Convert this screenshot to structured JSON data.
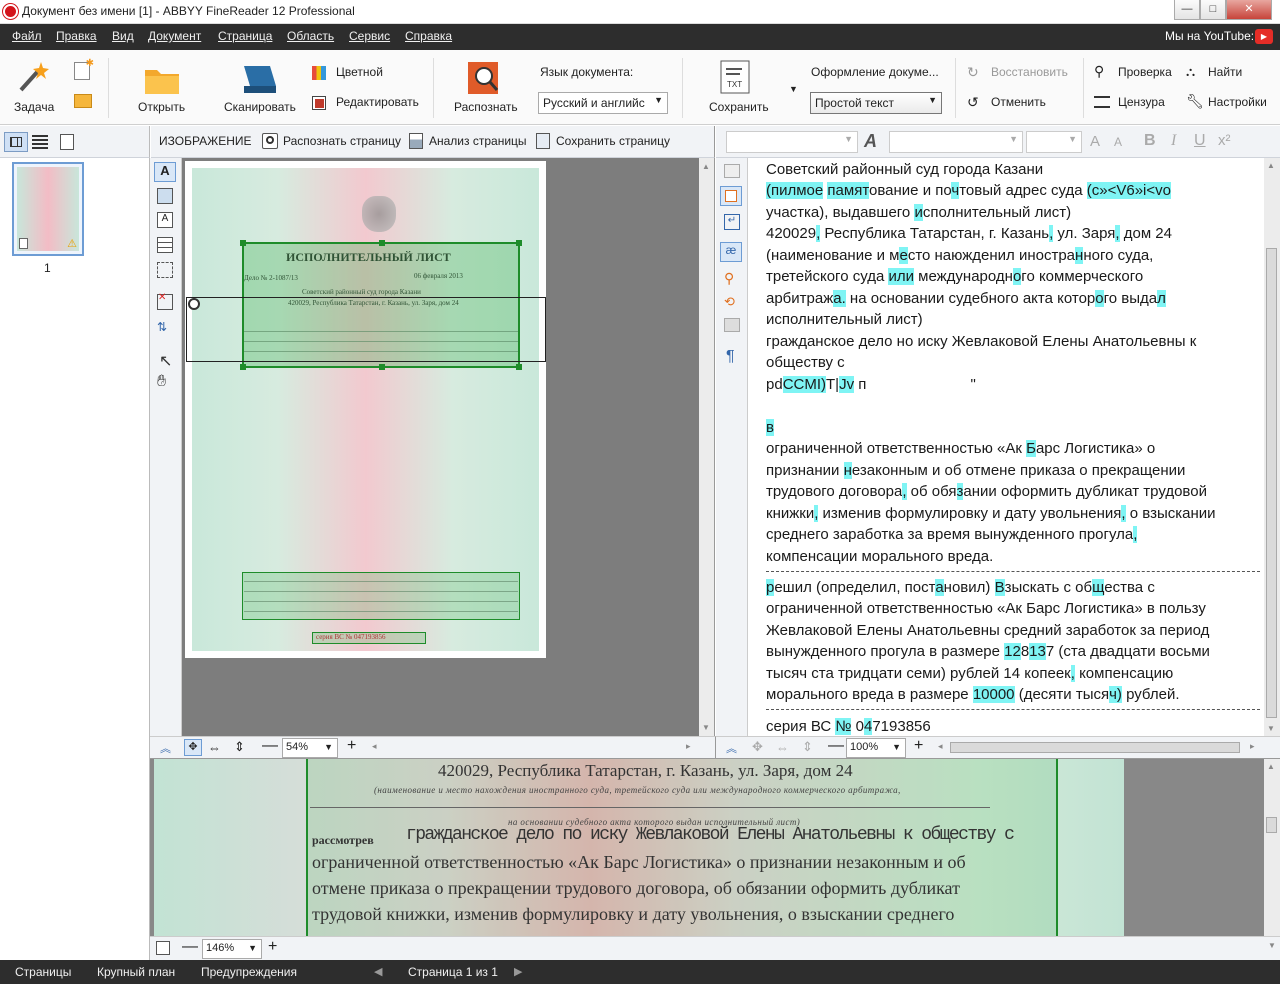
{
  "window": {
    "title": "Документ без имени [1] - ABBYY FineReader 12 Professional",
    "minimize": "—",
    "maximize": "□",
    "close": "✕"
  },
  "menu": [
    "Файл",
    "Правка",
    "Вид",
    "Документ",
    "Страница",
    "Область",
    "Сервис",
    "Справка"
  ],
  "youtube": "Мы на YouTube:",
  "toolbar": {
    "task": "Задача",
    "open": "Открыть",
    "scan": "Сканировать",
    "color": "Цветной",
    "edit": "Редактировать",
    "recognize": "Распознать",
    "lang_label": "Язык документа:",
    "lang_value": "Русский и английс",
    "save": "Сохранить",
    "format_label": "Оформление докуме...",
    "format_value": "Простой текст",
    "restore": "Восстановить",
    "undo": "Отменить",
    "check": "Проверка",
    "censor": "Цензура",
    "find": "Найти",
    "settings": "Настройки"
  },
  "image_header": {
    "title": "ИЗОБРАЖЕНИЕ",
    "recognize_page": "Распознать страницу",
    "analyze_page": "Анализ страницы",
    "save_page": "Сохранить страницу"
  },
  "text_toolbar": {
    "bold": "B",
    "italic": "I",
    "underline": "U",
    "superscript": "x²"
  },
  "thumb": {
    "page_number": "1"
  },
  "document": {
    "title": "ИСПОЛНИТЕЛЬНЫЙ ЛИСТ",
    "case": "Дело № 2-1087/13",
    "date": "06 февраля 2013",
    "court": "Советский районный суд города Казани",
    "address": "420029, Республика Татарстан, г. Казань, ул. Заря, дом 24",
    "serial": "серия ВС № 047193856"
  },
  "zoom_image": "54%",
  "zoom_text": "100%",
  "zoom_closeup": "146%",
  "closeup": {
    "line1": "420029, Республика Татарстан, г. Казань, ул. Заря, дом 24",
    "line2": "(наименование и место нахождения иностранного суда, третейского суда или международного коммерческого арбитража,",
    "line3": "на основании судебного акта которого выдан исполнительный лист)",
    "line4_label": "рассмотрев",
    "line4": "гражданское дело по иску Жевлаковой Елены Анатольевны к обществу с",
    "line5": "ограниченной ответственностью «Ак Барс Логистика» о признании незаконным и об",
    "line6": "отмене приказа о прекращении трудового договора, об обязании оформить дубликат",
    "line7": "трудовой книжки, изменив формулировку и дату увольнения, о взыскании среднего"
  },
  "status": {
    "pages": "Страницы",
    "closeup": "Крупный план",
    "warnings": "Предупреждения",
    "page_of": "Страница 1 из 1"
  },
  "colors": {
    "menubar": "#2d2d2d",
    "highlight": "#7ff4f4",
    "green_frame": "#1e8c2a"
  }
}
